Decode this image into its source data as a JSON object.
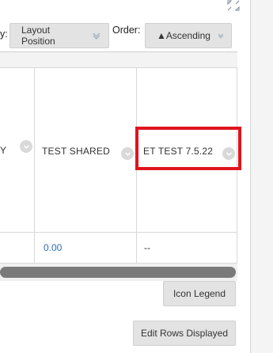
{
  "controls": {
    "sort_label_fragment": "y:",
    "layout_select_value": "Layout Position",
    "order_label": "Order:",
    "order_select_value": "▲Ascending"
  },
  "grid": {
    "columns": [
      {
        "header": "Y"
      },
      {
        "header": "TEST SHARED"
      },
      {
        "header": "ET TEST 7.5.22"
      }
    ],
    "rows": [
      {
        "cells": [
          "",
          "0.00",
          "--"
        ]
      }
    ]
  },
  "buttons": {
    "icon_legend": "Icon Legend",
    "edit_rows": "Edit Rows Displayed"
  },
  "colors": {
    "highlight": "#e0141e",
    "link_value": "#2a6fb0"
  }
}
